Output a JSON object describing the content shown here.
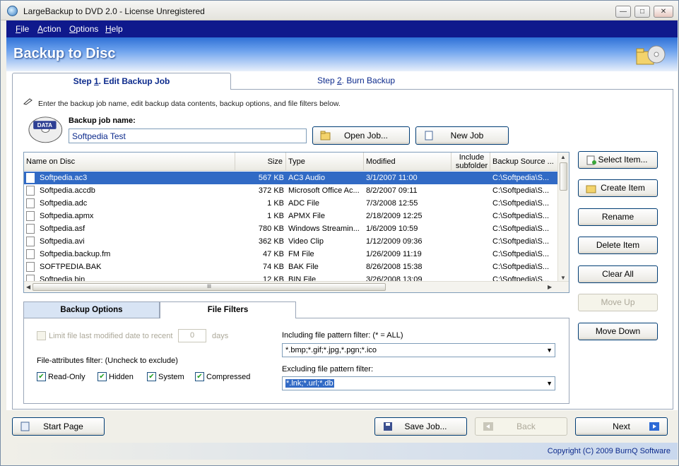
{
  "window": {
    "title": "LargeBackup to DVD 2.0 - License Unregistered"
  },
  "menu": [
    {
      "key": "F",
      "rest": "ile"
    },
    {
      "key": "A",
      "rest": "ction"
    },
    {
      "key": "O",
      "rest": "ptions"
    },
    {
      "key": "H",
      "rest": "elp"
    }
  ],
  "banner": {
    "title": "Backup to Disc"
  },
  "steps": {
    "step1": {
      "prefix": "Step ",
      "key": "1",
      "rest": ". Edit Backup Job"
    },
    "step2": {
      "prefix": "Step ",
      "key": "2",
      "rest": ". Burn Backup"
    }
  },
  "hint": "Enter the backup job name, edit backup data contents, backup options, and file filters below.",
  "job": {
    "label": "Backup job name:",
    "name": "Softpedia Test",
    "icon_text": "DATA"
  },
  "buttons": {
    "open_job": "Open Job...",
    "new_job": "New Job",
    "select_item": "Select Item...",
    "create_item": "Create Item",
    "rename": "Rename",
    "delete_item": "Delete Item",
    "clear_all": "Clear All",
    "move_up": "Move Up",
    "move_down": "Move Down",
    "start_page": "Start Page",
    "save_job": "Save Job...",
    "back": "Back",
    "next": "Next"
  },
  "list": {
    "columns": [
      "Name on Disc",
      "Size",
      "Type",
      "Modified",
      "Include subfolder",
      "Backup Source ..."
    ],
    "rows": [
      {
        "name": "Softpedia.ac3",
        "size": "567 KB",
        "type": "AC3 Audio",
        "modified": "3/1/2007 11:00",
        "sub": "",
        "source": "C:\\Softpedia\\S...",
        "selected": true
      },
      {
        "name": "Softpedia.accdb",
        "size": "372 KB",
        "type": "Microsoft Office Ac...",
        "modified": "8/2/2007 09:11",
        "sub": "",
        "source": "C:\\Softpedia\\S..."
      },
      {
        "name": "Softpedia.adc",
        "size": "1 KB",
        "type": "ADC File",
        "modified": "7/3/2008 12:55",
        "sub": "",
        "source": "C:\\Softpedia\\S..."
      },
      {
        "name": "Softpedia.apmx",
        "size": "1 KB",
        "type": "APMX File",
        "modified": "2/18/2009 12:25",
        "sub": "",
        "source": "C:\\Softpedia\\S..."
      },
      {
        "name": "Softpedia.asf",
        "size": "780 KB",
        "type": "Windows Streamin...",
        "modified": "1/6/2009 10:59",
        "sub": "",
        "source": "C:\\Softpedia\\S..."
      },
      {
        "name": "Softpedia.avi",
        "size": "362 KB",
        "type": "Video Clip",
        "modified": "1/12/2009 09:36",
        "sub": "",
        "source": "C:\\Softpedia\\S..."
      },
      {
        "name": "Softpedia.backup.fm",
        "size": "47 KB",
        "type": "FM File",
        "modified": "1/26/2009 11:19",
        "sub": "",
        "source": "C:\\Softpedia\\S..."
      },
      {
        "name": "SOFTPEDIA.BAK",
        "size": "74 KB",
        "type": "BAK File",
        "modified": "8/26/2008 15:38",
        "sub": "",
        "source": "C:\\Softpedia\\S..."
      },
      {
        "name": "Softpedia.bin",
        "size": "12 KB",
        "type": "BIN File",
        "modified": "3/26/2008 13:09",
        "sub": "",
        "source": "C:\\Softpedia\\S..."
      }
    ]
  },
  "options_tabs": [
    "Backup Options",
    "File Filters"
  ],
  "filters": {
    "limit_label": "Limit file last modified date to recent",
    "days_value": "0",
    "days_label": "days",
    "attr_label": "File-attributes filter:  (Uncheck to exclude)",
    "attrs": [
      {
        "label": "Read-Only",
        "checked": true
      },
      {
        "label": "Hidden",
        "checked": true
      },
      {
        "label": "System",
        "checked": true
      },
      {
        "label": "Compressed",
        "checked": true
      }
    ],
    "include_label": "Including file pattern filter:  (* = ALL)",
    "include_value": "*.bmp;*.gif;*.jpg,*.pgn;*.ico",
    "exclude_label": "Excluding file pattern filter:",
    "exclude_value": "*.lnk;*.url;*.db"
  },
  "status": {
    "copyright": "Copyright (C) 2009 BurnQ Software"
  }
}
